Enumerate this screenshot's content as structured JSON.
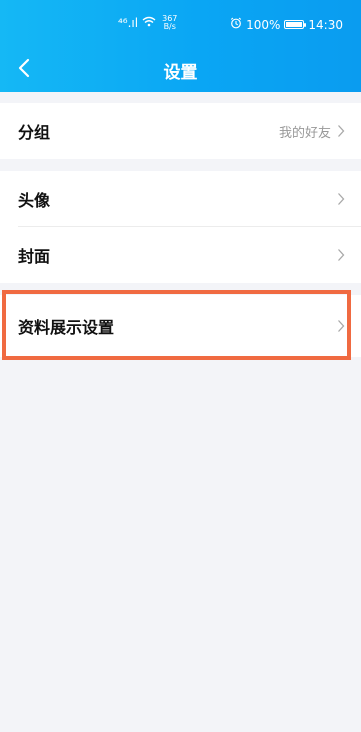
{
  "status_bar": {
    "signal": "⁴⁶.ıl",
    "net_speed_value": "367",
    "net_speed_unit": "B/s",
    "battery_percent": "100%",
    "time": "14:30"
  },
  "nav": {
    "title": "设置"
  },
  "sections": [
    {
      "rows": [
        {
          "label": "分组",
          "value": "我的好友"
        }
      ]
    },
    {
      "rows": [
        {
          "label": "头像",
          "value": ""
        },
        {
          "label": "封面",
          "value": ""
        }
      ]
    },
    {
      "rows": [
        {
          "label": "资料展示设置",
          "value": ""
        }
      ]
    }
  ],
  "colors": {
    "header_gradient_start": "#15b8f5",
    "header_gradient_end": "#0a9cf0",
    "page_background": "#f3f4f8",
    "highlight_border": "#f06a41"
  }
}
